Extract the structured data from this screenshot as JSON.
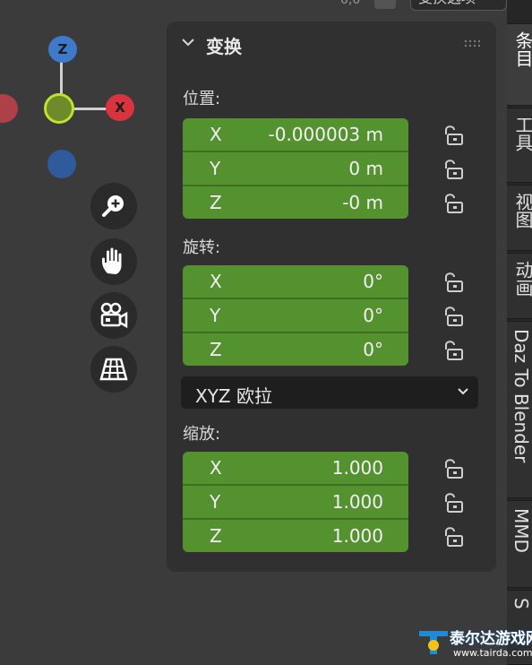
{
  "header": {
    "dropdown_text": "变换选项",
    "mini_text": "0,0"
  },
  "gizmo": {
    "z_label": "Z",
    "x_label": "X",
    "colors": {
      "z": "#3f79c9",
      "x": "#d8333e",
      "y": "#7fa82a",
      "neg_x": "#c5424b",
      "neg_z": "#2f5a9c"
    }
  },
  "nav_tools": [
    {
      "name": "zoom",
      "icon": "zoom-in-icon"
    },
    {
      "name": "pan",
      "icon": "hand-icon"
    },
    {
      "name": "camera",
      "icon": "camera-icon"
    },
    {
      "name": "perspective",
      "icon": "grid-icon"
    }
  ],
  "panel": {
    "title": "变换",
    "location": {
      "label": "位置:",
      "fields": [
        {
          "axis": "X",
          "value": "-0.000003 m"
        },
        {
          "axis": "Y",
          "value": "0 m"
        },
        {
          "axis": "Z",
          "value": "-0 m"
        }
      ]
    },
    "rotation": {
      "label": "旋转:",
      "fields": [
        {
          "axis": "X",
          "value": "0°"
        },
        {
          "axis": "Y",
          "value": "0°"
        },
        {
          "axis": "Z",
          "value": "0°"
        }
      ]
    },
    "rotation_mode": "XYZ 欧拉",
    "scale": {
      "label": "缩放:",
      "fields": [
        {
          "axis": "X",
          "value": "1.000"
        },
        {
          "axis": "Y",
          "value": "1.000"
        },
        {
          "axis": "Z",
          "value": "1.000"
        }
      ]
    },
    "field_color": "#54922f"
  },
  "tabs": [
    {
      "label": "条目",
      "active": true
    },
    {
      "label": "工具"
    },
    {
      "label": "视图"
    },
    {
      "label": "动画"
    },
    {
      "label": "Daz To Blender"
    },
    {
      "label": "MMD"
    },
    {
      "label": "S"
    }
  ],
  "watermark": {
    "title": "泰尔达游戏网",
    "url": "www.tairda.com"
  }
}
